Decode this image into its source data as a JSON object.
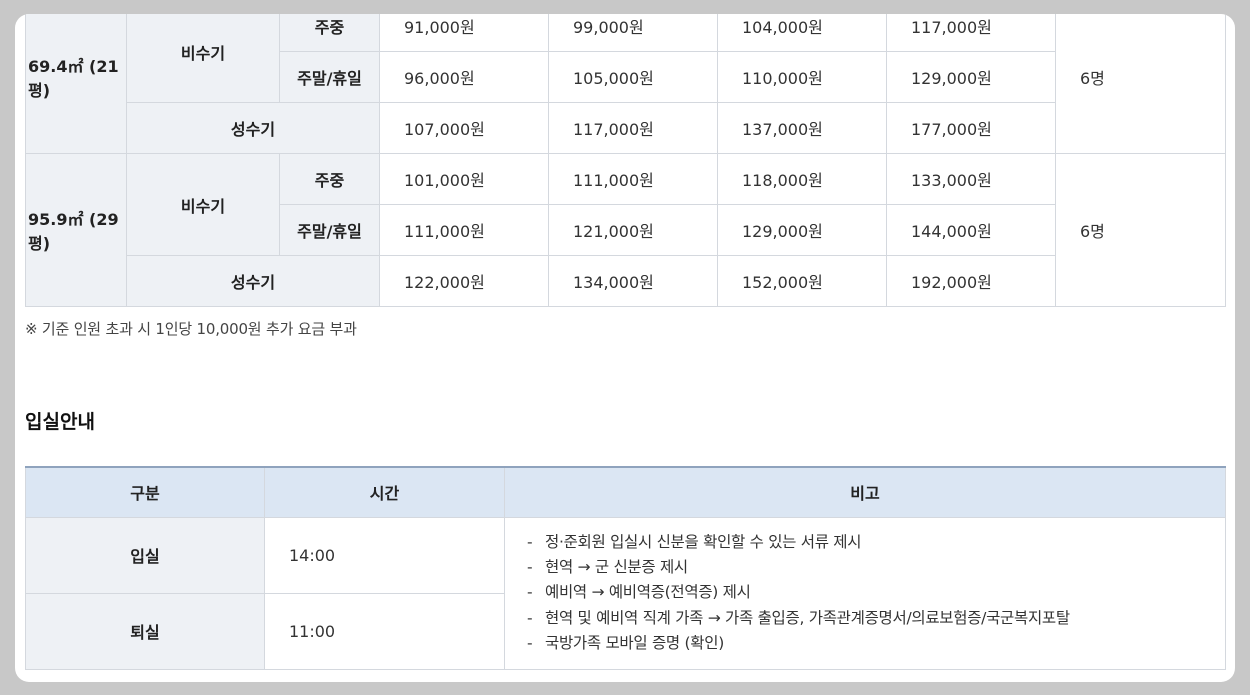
{
  "price_table": {
    "rows": [
      {
        "area": "69.4㎡ (21평)",
        "offpeak_label": "비수기",
        "weekday_label": "주중",
        "weekend_label": "주말/휴일",
        "peak_label": "성수기",
        "weekday": [
          "91,000원",
          "99,000원",
          "104,000원",
          "117,000원"
        ],
        "weekend": [
          "96,000원",
          "105,000원",
          "110,000원",
          "129,000원"
        ],
        "peak": [
          "107,000원",
          "117,000원",
          "137,000원",
          "177,000원"
        ],
        "capacity": "6명"
      },
      {
        "area": "95.9㎡ (29평)",
        "offpeak_label": "비수기",
        "weekday_label": "주중",
        "weekend_label": "주말/휴일",
        "peak_label": "성수기",
        "weekday": [
          "101,000원",
          "111,000원",
          "118,000원",
          "133,000원"
        ],
        "weekend": [
          "111,000원",
          "121,000원",
          "129,000원",
          "144,000원"
        ],
        "peak": [
          "122,000원",
          "134,000원",
          "152,000원",
          "192,000원"
        ],
        "capacity": "6명"
      }
    ],
    "note": "※ 기준 인원 초과 시 1인당 10,000원 추가 요금 부과"
  },
  "checkin": {
    "title": "입실안내",
    "headers": [
      "구분",
      "시간",
      "비고"
    ],
    "rows": [
      {
        "label": "입실",
        "time": "14:00"
      },
      {
        "label": "퇴실",
        "time": "11:00"
      }
    ],
    "dash": "-",
    "notes": [
      "정·준회원 입실시 신분을 확인할 수 있는 서류 제시",
      "현역 → 군 신분증 제시",
      "예비역 → 예비역증(전역증) 제시",
      "현역 및 예비역 직계 가족 → 가족 출입증, 가족관계증명서/의료보험증/국군복지포탈",
      "국방가족 모바일 증명 (확인)"
    ]
  }
}
